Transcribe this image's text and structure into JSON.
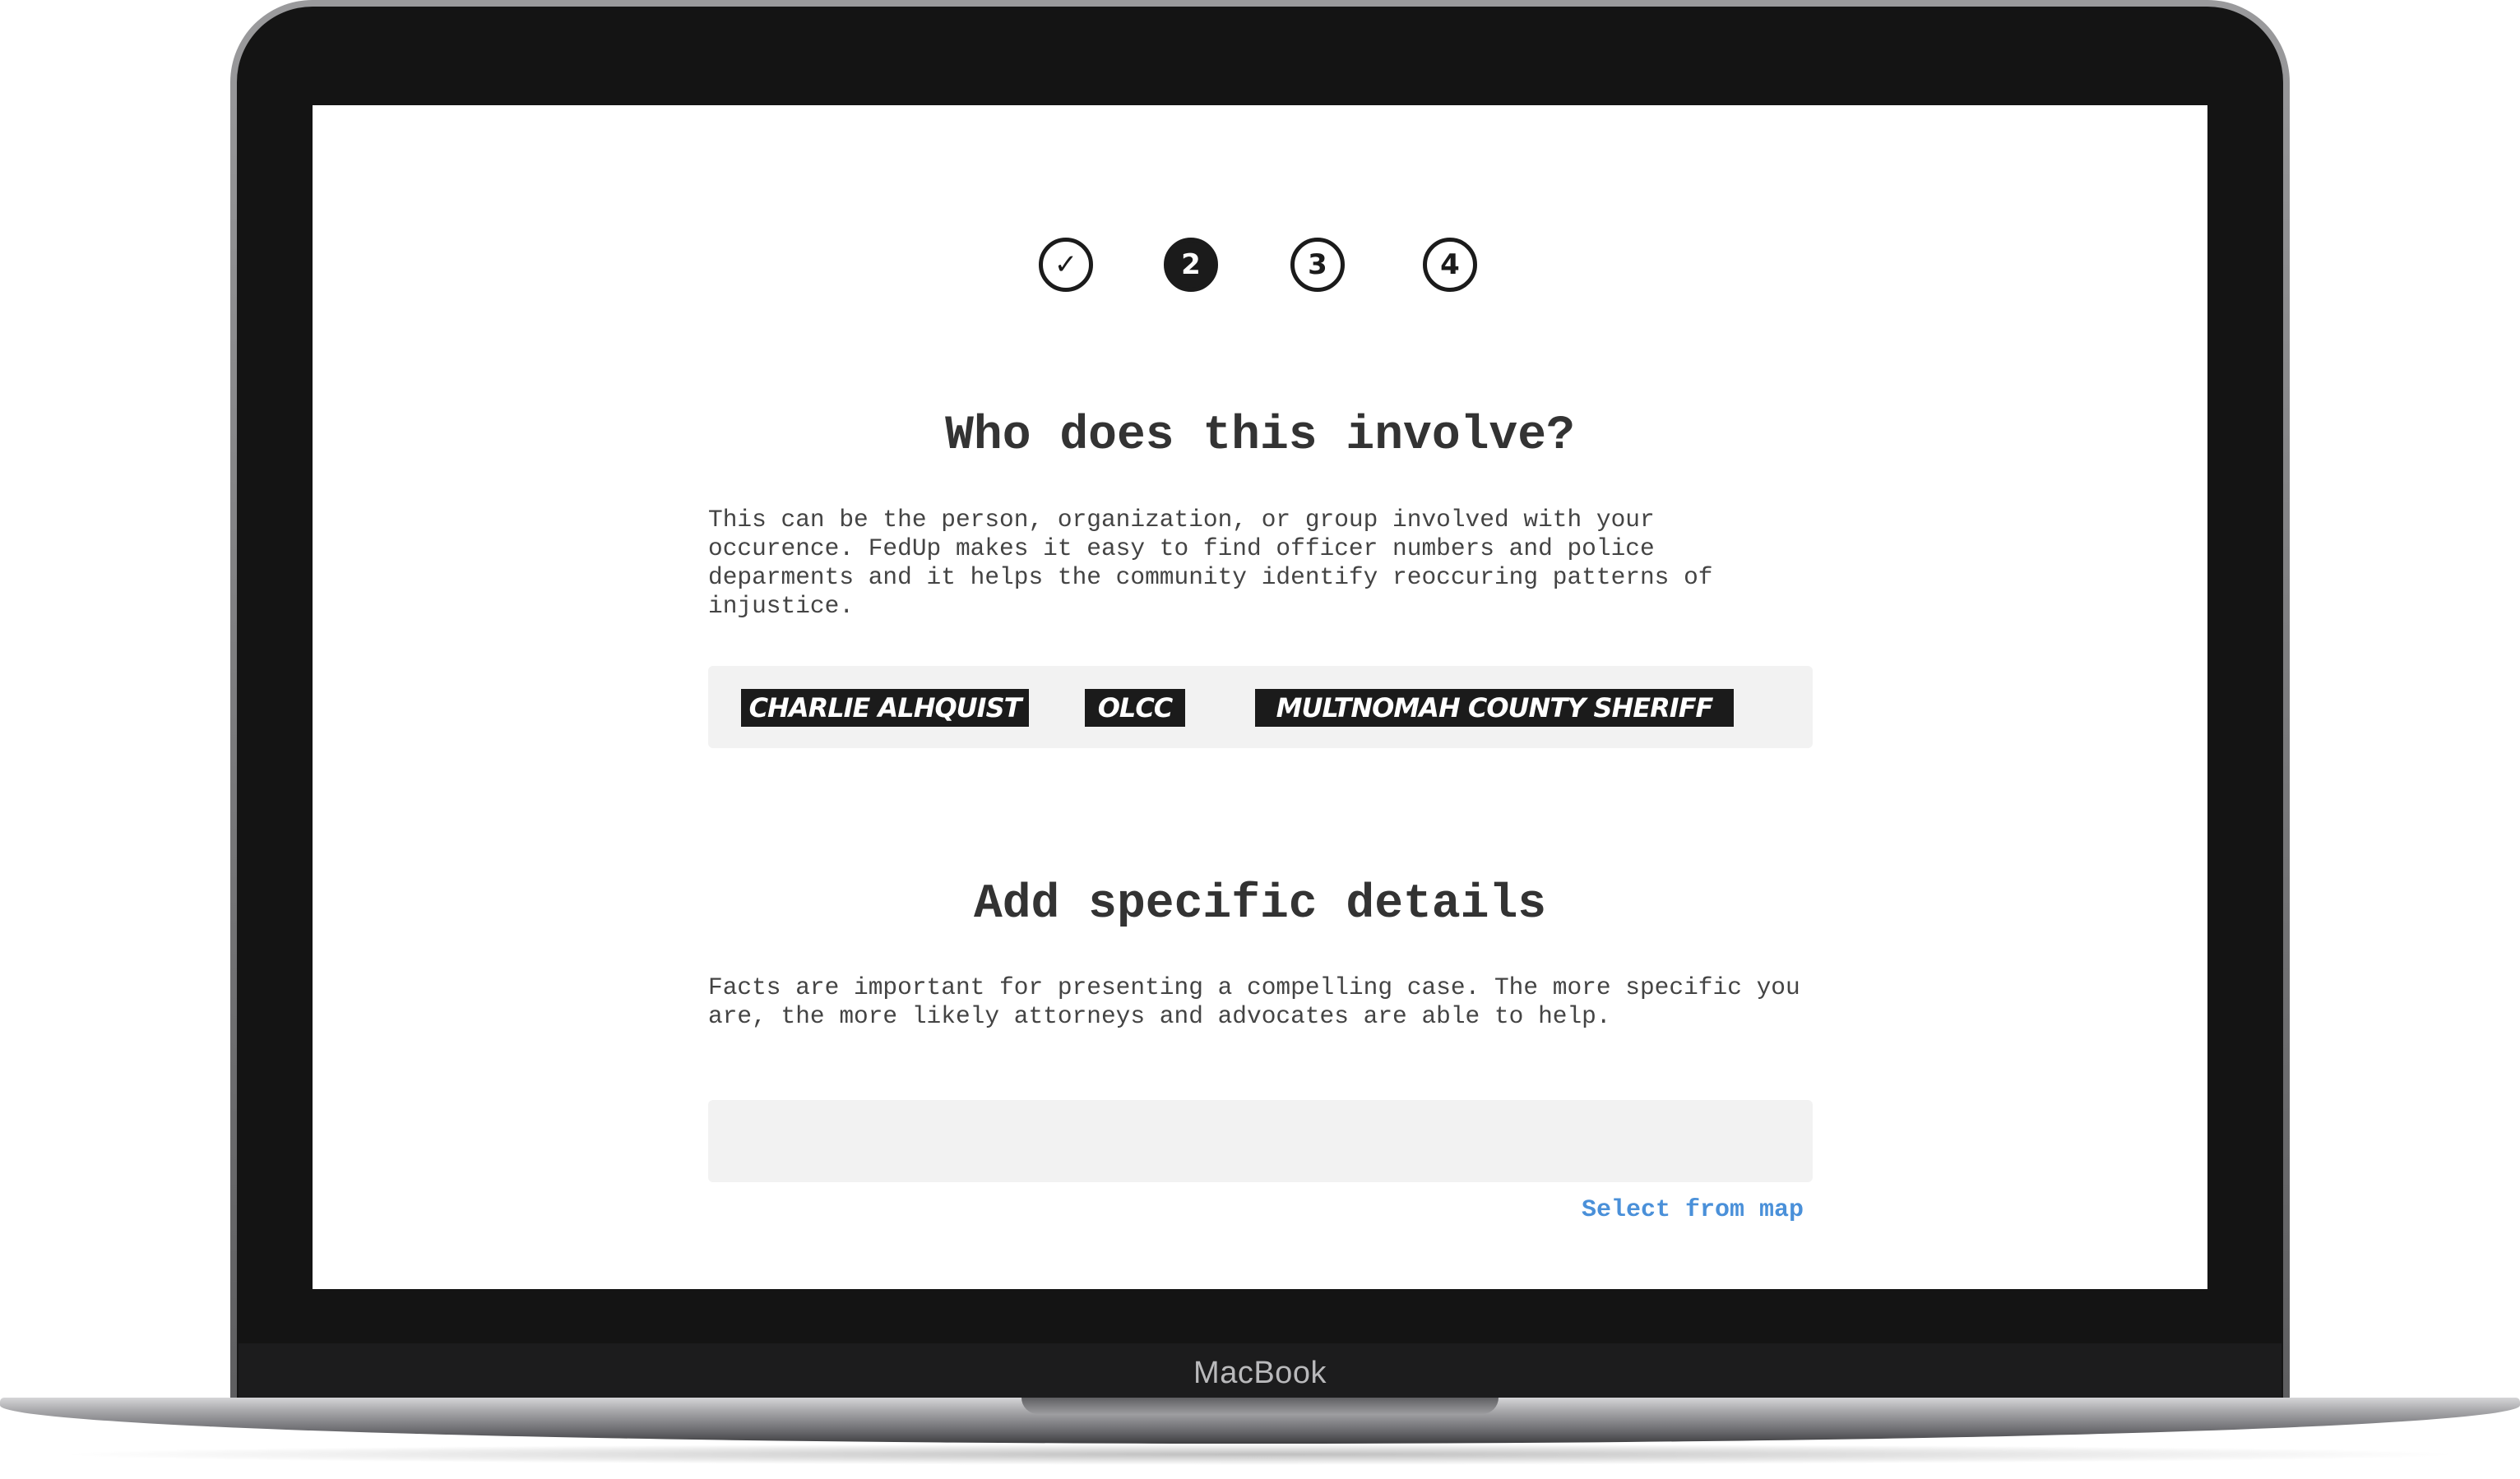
{
  "device": {
    "brand_label": "MacBook"
  },
  "stepper": {
    "steps": [
      {
        "label": "✓",
        "state": "completed"
      },
      {
        "label": "2",
        "state": "active"
      },
      {
        "label": "3",
        "state": "upcoming"
      },
      {
        "label": "4",
        "state": "upcoming"
      }
    ]
  },
  "involve_section": {
    "title": "Who does this involve?",
    "description": "This can be the person, organization, or group involved with your occurence. FedUp makes it easy to find officer numbers and police deparments and it helps the community identify reoccuring patterns of injustice.",
    "tags": [
      "Charlie Alhquist",
      "OLCC",
      "Multnomah County Sheriff"
    ]
  },
  "details_section": {
    "title": "Add specific details",
    "description": "Facts are important for presenting a compelling case. The more specific you are, the more likely attorneys and advocates are able to help.",
    "input_value": "",
    "map_link_label": "Select from map"
  },
  "colors": {
    "accent_link": "#4a90d9",
    "tag_background": "#1b1b1b",
    "field_background": "#f2f2f2",
    "text": "#333333"
  }
}
